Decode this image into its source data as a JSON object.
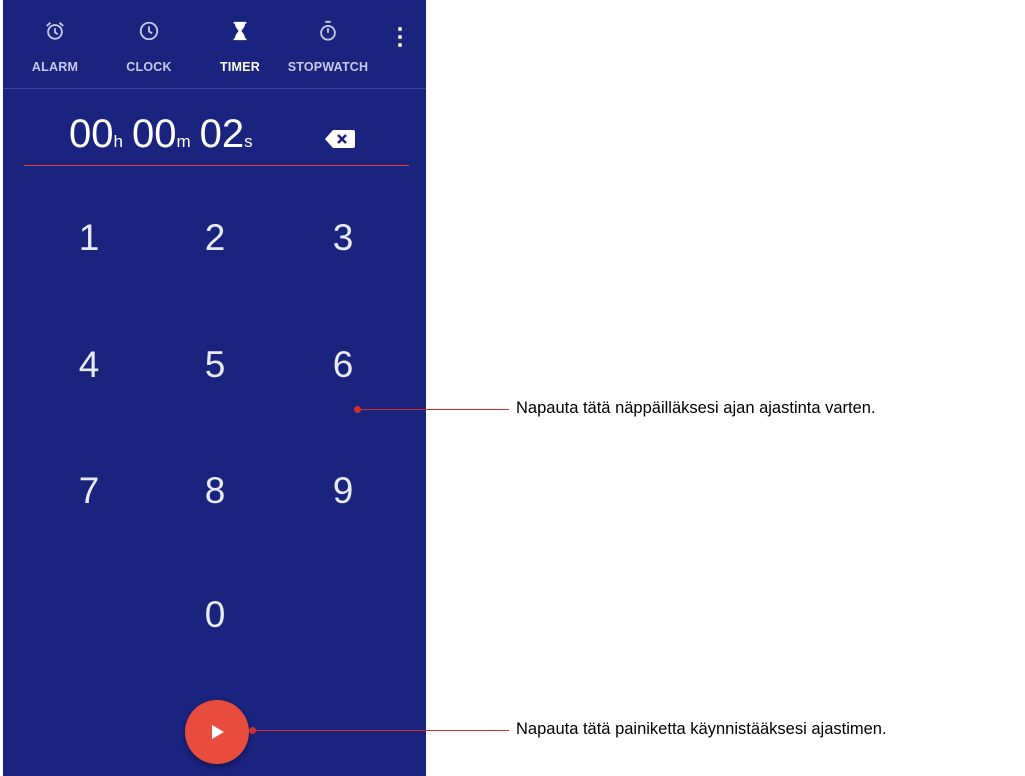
{
  "tabs": [
    {
      "label": "ALARM",
      "icon": "alarm-icon"
    },
    {
      "label": "CLOCK",
      "icon": "clock-icon"
    },
    {
      "label": "TIMER",
      "icon": "hourglass-icon",
      "active": true
    },
    {
      "label": "STOPWATCH",
      "icon": "stopwatch-icon"
    }
  ],
  "timer": {
    "hours": "00",
    "hours_unit": "h",
    "minutes": "00",
    "minutes_unit": "m",
    "seconds": "02",
    "seconds_unit": "s"
  },
  "keypad": [
    "1",
    "2",
    "3",
    "4",
    "5",
    "6",
    "7",
    "8",
    "9",
    "0"
  ],
  "callouts": {
    "keypad": "Napauta tätä näppäilläksesi ajan ajastinta varten.",
    "start": "Napauta tätä painiketta käynnistääksesi ajastimen."
  },
  "colors": {
    "background": "#1a237e",
    "accent": "#e84c3d",
    "callout": "#d32f2f"
  }
}
